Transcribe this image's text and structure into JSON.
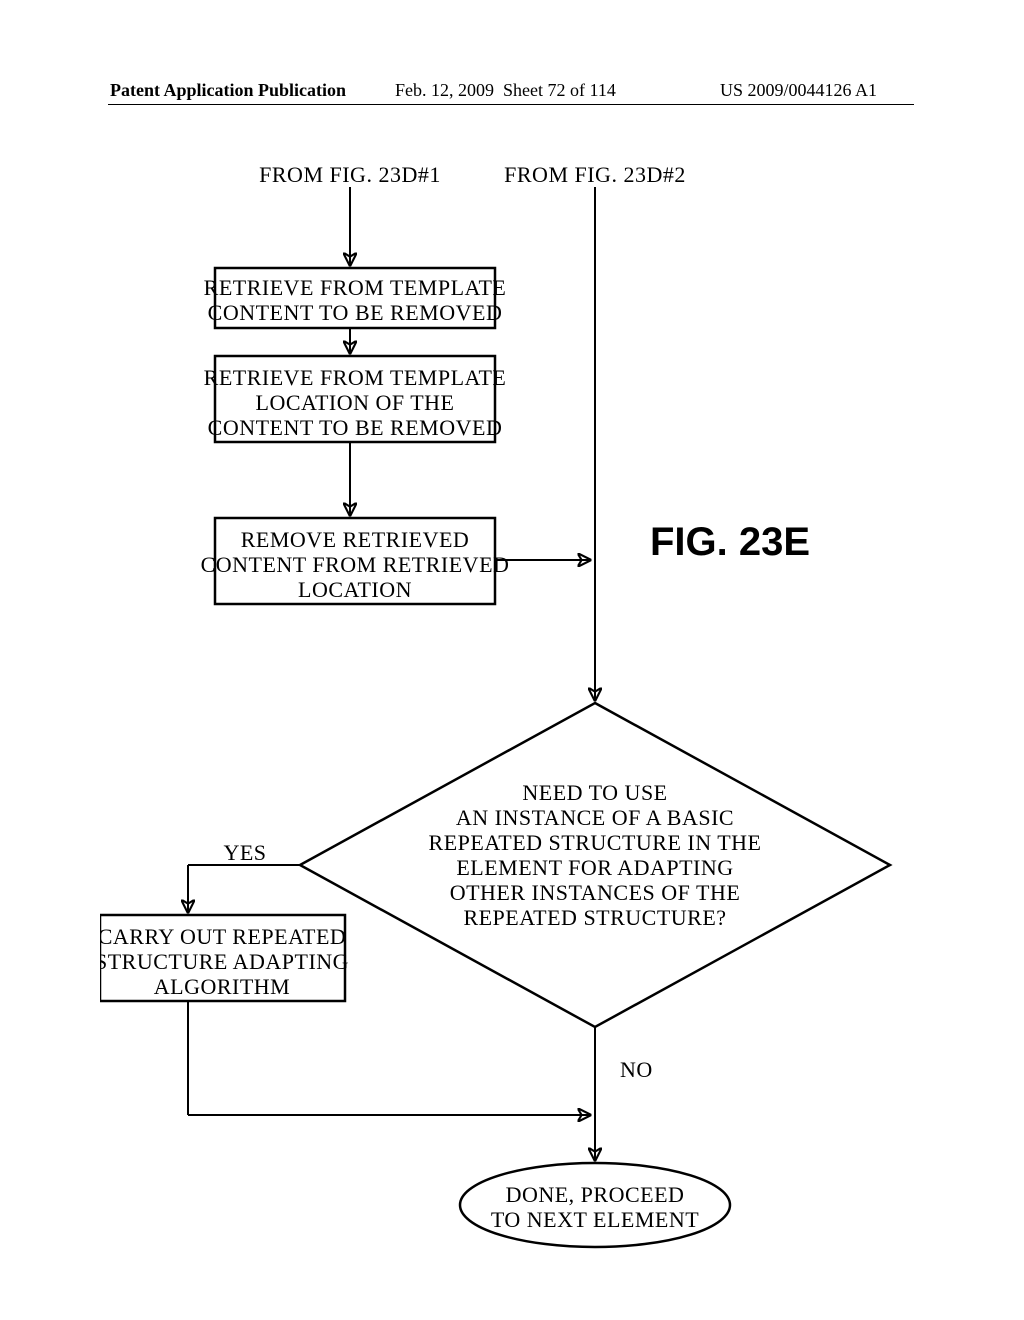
{
  "header": {
    "publication": "Patent Application Publication",
    "date": "Feb. 12, 2009",
    "sheet": "Sheet 72 of 114",
    "pubNumber": "US 2009/0044126 A1"
  },
  "flowchart": {
    "fromLabel1": "FROM FIG. 23D#1",
    "fromLabel2": "FROM FIG. 23D#2",
    "box1_l1": "RETRIEVE FROM TEMPLATE",
    "box1_l2": "CONTENT TO BE REMOVED",
    "box2_l1": "RETRIEVE FROM TEMPLATE",
    "box2_l2": "LOCATION OF THE",
    "box2_l3": "CONTENT TO BE REMOVED",
    "box3_l1": "REMOVE RETRIEVED",
    "box3_l2": "CONTENT FROM RETRIEVED",
    "box3_l3": "LOCATION",
    "decision_l1": "NEED TO USE",
    "decision_l2": "AN INSTANCE OF A BASIC",
    "decision_l3": "REPEATED STRUCTURE IN THE",
    "decision_l4": "ELEMENT FOR ADAPTING",
    "decision_l5": "OTHER INSTANCES OF THE",
    "decision_l6": "REPEATED STRUCTURE?",
    "yesLabel": "YES",
    "noLabel": "NO",
    "box4_l1": "CARRY OUT REPEATED",
    "box4_l2": "STRUCTURE ADAPTING",
    "box4_l3": "ALGORITHM",
    "terminator_l1": "DONE, PROCEED",
    "terminator_l2": "TO NEXT ELEMENT",
    "figLabel": "FIG.  23E"
  }
}
